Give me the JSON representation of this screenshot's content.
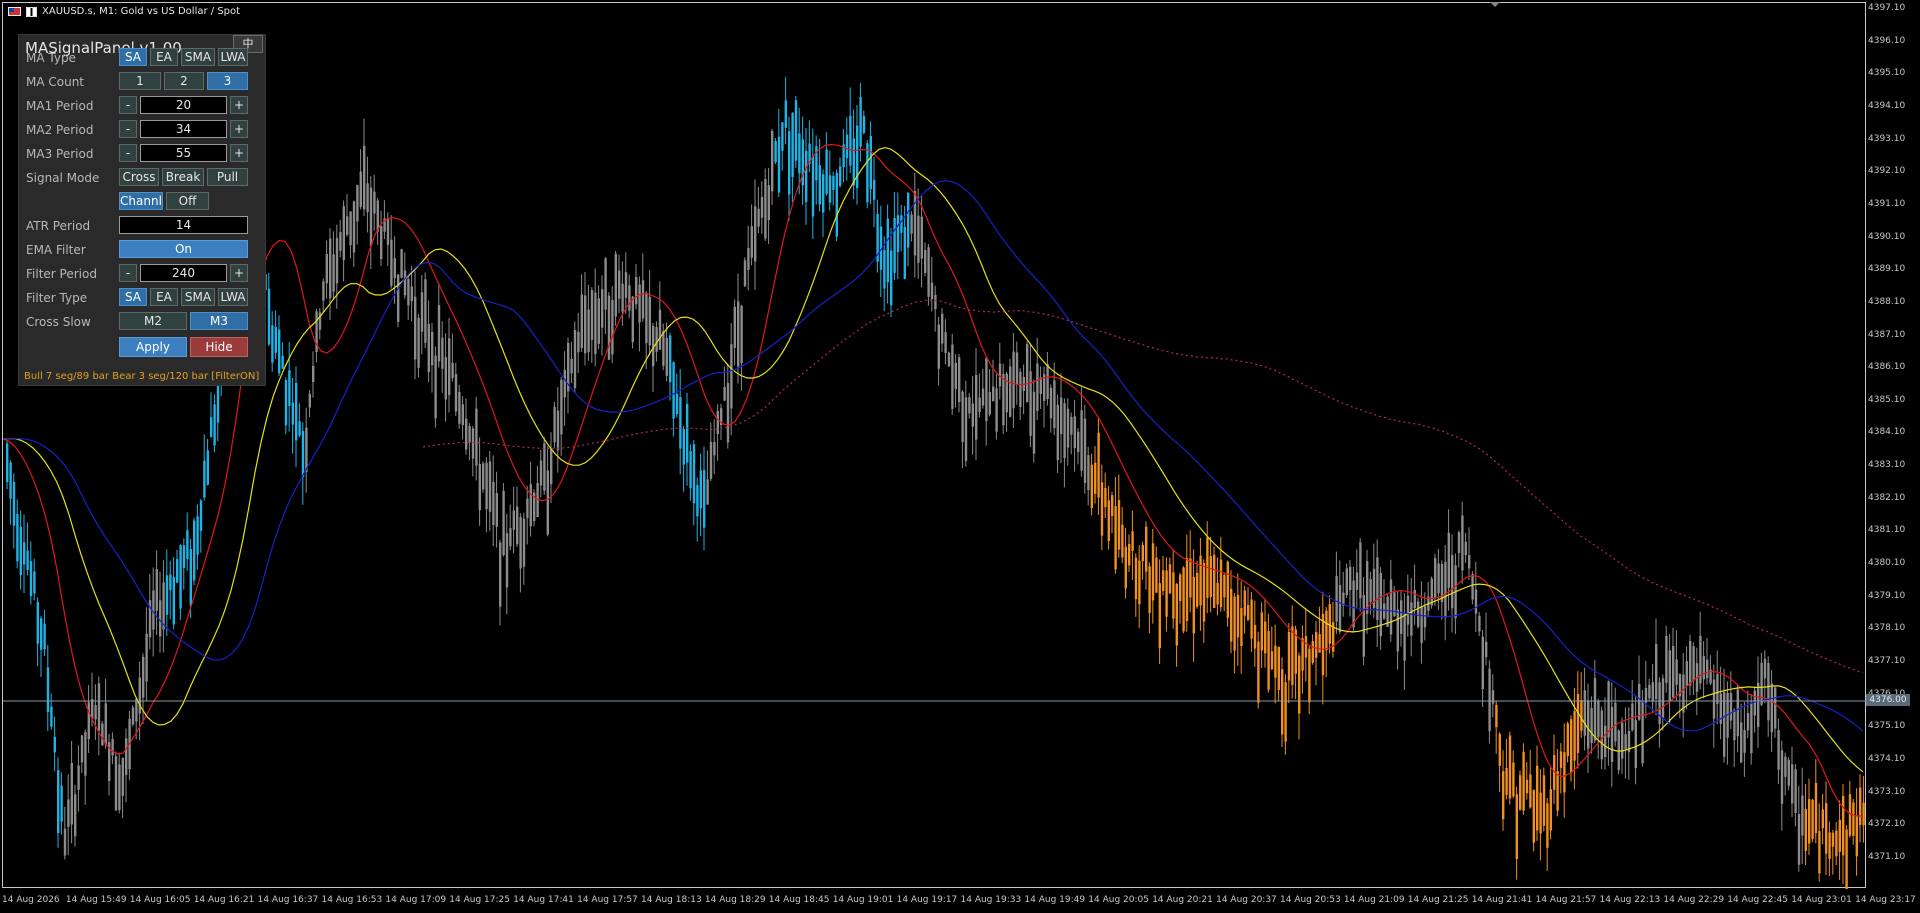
{
  "window": {
    "title": "XAUUSD.s, M1:  Gold vs US Dollar / Spot",
    "icons": [
      "flag-icon",
      "chart-type-icon"
    ]
  },
  "chart": {
    "symbol": "XAUUSD.s",
    "timeframe": "M1",
    "background": "#000000",
    "bull_color": "#1fb4e6",
    "bear_color": "#f0901e",
    "neutral_color": "#8c8c8c",
    "ma1_color": "#e01818",
    "ma2_color": "#e6e018",
    "ma3_color": "#1820c8",
    "filter_color": "#b4285a",
    "current_price": "4376.00",
    "price_axis": [
      "4397.10",
      "4396.10",
      "4395.10",
      "4394.10",
      "4393.10",
      "4392.10",
      "4391.10",
      "4390.10",
      "4389.10",
      "4388.10",
      "4387.10",
      "4386.10",
      "4385.10",
      "4384.10",
      "4383.10",
      "4382.10",
      "4381.10",
      "4380.10",
      "4379.10",
      "4378.10",
      "4377.10",
      "4376.10",
      "4375.10",
      "4374.10",
      "4373.10",
      "4372.10",
      "4371.10"
    ],
    "time_axis": [
      "14 Aug 2026",
      "14 Aug 15:49",
      "14 Aug 16:05",
      "14 Aug 16:21",
      "14 Aug 16:37",
      "14 Aug 16:53",
      "14 Aug 17:09",
      "14 Aug 17:25",
      "14 Aug 17:41",
      "14 Aug 17:57",
      "14 Aug 18:13",
      "14 Aug 18:29",
      "14 Aug 18:45",
      "14 Aug 19:01",
      "14 Aug 19:17",
      "14 Aug 19:33",
      "14 Aug 19:49",
      "14 Aug 20:05",
      "14 Aug 20:21",
      "14 Aug 20:37",
      "14 Aug 20:53",
      "14 Aug 21:09",
      "14 Aug 21:25",
      "14 Aug 21:41",
      "14 Aug 21:57",
      "14 Aug 22:13",
      "14 Aug 22:29",
      "14 Aug 22:45",
      "14 Aug 23:01",
      "14 Aug 23:17"
    ]
  },
  "panel": {
    "title": "MASignalPanel v1.00",
    "lang_button": "中",
    "rows": {
      "ma_type": {
        "label": "MA Type",
        "options": [
          "SA",
          "EA",
          "SMA",
          "LWA"
        ],
        "selected": "SA"
      },
      "ma_count": {
        "label": "MA Count",
        "options": [
          "1",
          "2",
          "3"
        ],
        "selected": "3"
      },
      "ma1_period": {
        "label": "MA1 Period",
        "minus": "-",
        "value": "20",
        "plus": "+"
      },
      "ma2_period": {
        "label": "MA2 Period",
        "minus": "-",
        "value": "34",
        "plus": "+"
      },
      "ma3_period": {
        "label": "MA3 Period",
        "minus": "-",
        "value": "55",
        "plus": "+"
      },
      "signal_mode": {
        "label": "Signal Mode",
        "options": [
          "Cross",
          "Break",
          "Pull"
        ],
        "options2": [
          "Channl",
          "Off"
        ],
        "selected": "Channl"
      },
      "atr_period": {
        "label": "ATR Period",
        "value": "14"
      },
      "ema_filter": {
        "label": "EMA Filter",
        "value": "On"
      },
      "filter_period": {
        "label": "Filter Period",
        "minus": "-",
        "value": "240",
        "plus": "+"
      },
      "filter_type": {
        "label": "Filter Type",
        "options": [
          "SA",
          "EA",
          "SMA",
          "LWA"
        ],
        "selected": "SA"
      },
      "cross_slow": {
        "label": "Cross Slow",
        "options": [
          "M2",
          "M3"
        ],
        "selected": "M3"
      }
    },
    "apply": "Apply",
    "hide": "Hide",
    "status": "Bull 7 seg/89 bar   Bear 3 seg/120 bar  [FilterON]"
  }
}
